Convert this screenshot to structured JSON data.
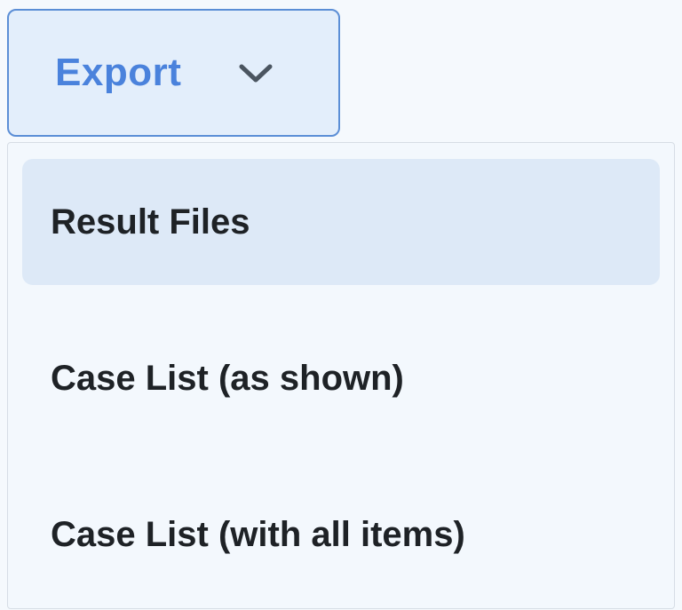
{
  "export_button": {
    "label": "Export",
    "icon": "chevron-down-icon",
    "accent_color": "#4a82dc"
  },
  "menu": {
    "items": [
      {
        "label": "Result Files",
        "highlighted": true
      },
      {
        "label": "Case List (as shown)",
        "highlighted": false
      },
      {
        "label": "Case List (with all items)",
        "highlighted": false
      }
    ]
  }
}
